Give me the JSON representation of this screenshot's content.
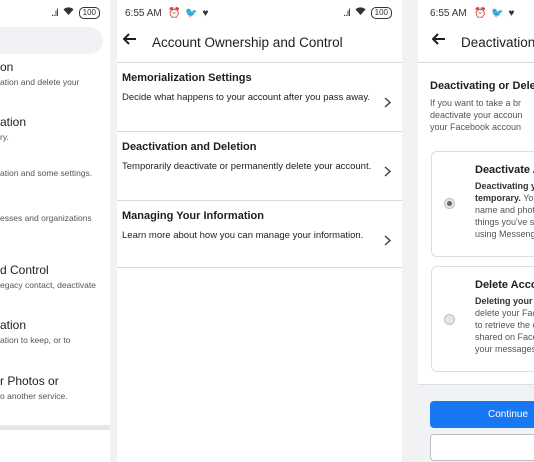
{
  "left_panel": {
    "status": {
      "signal": "..ıl",
      "battery": "100"
    },
    "items": [
      {
        "title": "on",
        "desc": "ation and delete your"
      },
      {
        "title": "ation",
        "desc": "ry."
      },
      {
        "title": "",
        "desc": "ation and some settings."
      },
      {
        "title": "",
        "desc": "esses and organizations"
      },
      {
        "title": "d Control",
        "desc": "egacy contact, deactivate"
      },
      {
        "title": "ation",
        "desc": "ation to keep, or to"
      },
      {
        "title": "r Photos or",
        "desc": "o another service."
      }
    ]
  },
  "middle_panel": {
    "status": {
      "time": "6:55 AM",
      "icons": "⏰ 🐦 ♥",
      "signal": "..ıl",
      "battery": "100"
    },
    "header": {
      "back_icon": "arrow-left-icon",
      "title": "Account Ownership and Control"
    },
    "items": [
      {
        "title": "Memorialization Settings",
        "desc": "Decide what happens to your account after you pass away."
      },
      {
        "title": "Deactivation and Deletion",
        "desc": "Temporarily deactivate or permanently delete your account."
      },
      {
        "title": "Managing Your Information",
        "desc": "Learn more about how you can manage your information."
      }
    ]
  },
  "right_panel": {
    "status": {
      "time": "6:55 AM",
      "icons": "⏰ 🐦 ♥"
    },
    "header": {
      "title": "Deactivation"
    },
    "section_title": "Deactivating or Dele",
    "section_desc": [
      "If you want to take a br",
      "deactivate your accoun",
      "your Facebook accoun"
    ],
    "options": [
      {
        "title": "Deactivate Ac",
        "bold_lines": [
          "Deactivating yo",
          "temporary."
        ],
        "rest": "Your",
        "lines": [
          "name and photo",
          "things you've sh",
          "using Messeng"
        ],
        "selected": true
      },
      {
        "title": "Delete Accou",
        "bold_lines": [
          "Deleting your a"
        ],
        "rest": "",
        "lines": [
          "delete your Fac",
          "to retrieve the c",
          "shared on Faceb",
          "your messages"
        ],
        "selected": false
      }
    ],
    "continue_label": "Continue"
  }
}
